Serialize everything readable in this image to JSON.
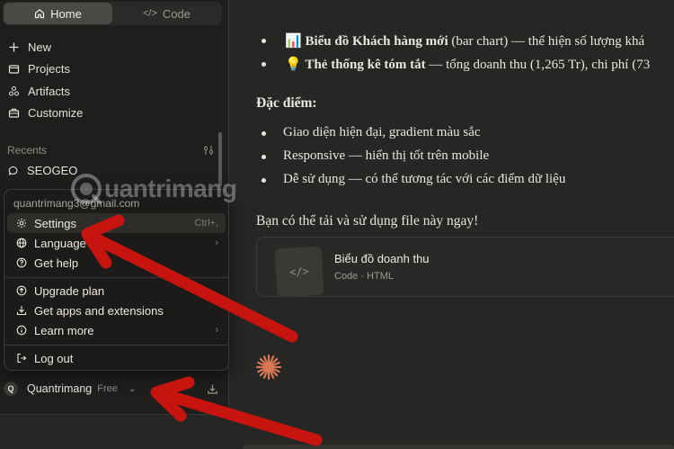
{
  "sidebar": {
    "modes": [
      {
        "label": "Home",
        "icon": "home-icon",
        "active": true
      },
      {
        "label": "Code",
        "icon": "code-icon",
        "active": false
      }
    ],
    "nav": [
      {
        "label": "New",
        "icon": "plus-icon"
      },
      {
        "label": "Projects",
        "icon": "folder-icon"
      },
      {
        "label": "Artifacts",
        "icon": "artifacts-icon"
      },
      {
        "label": "Customize",
        "icon": "briefcase-icon"
      }
    ],
    "recents_label": "Recents",
    "recent_item": "SEOGEO",
    "footer": {
      "avatar": "Q",
      "name": "Quantrimang",
      "plan": "Free"
    }
  },
  "menu": {
    "email": "quantrimang3@gmail.com",
    "items": [
      {
        "label": "Settings",
        "icon": "gear-icon",
        "shortcut": "Ctrl+,",
        "highlighted": true
      },
      {
        "label": "Language",
        "icon": "globe-icon",
        "submenu": true
      },
      {
        "label": "Get help",
        "icon": "help-icon"
      },
      {
        "label": "Upgrade plan",
        "icon": "upgrade-icon"
      },
      {
        "label": "Get apps and extensions",
        "icon": "download-icon"
      },
      {
        "label": "Learn more",
        "icon": "info-icon",
        "submenu": true
      },
      {
        "label": "Log out",
        "icon": "logout-icon"
      }
    ]
  },
  "main": {
    "bullet1": {
      "emoji": "📊",
      "bold": "Biểu đồ Khách hàng mới",
      "rest": " (bar chart) — thể hiện số lượng khá"
    },
    "bullet2": {
      "emoji": "💡",
      "bold": "Thẻ thống kê tóm tắt",
      "rest": " — tổng doanh thu (1,265 Tr), chi phí (73"
    },
    "features_heading": "Đặc điểm:",
    "features": [
      "Giao diện hiện đại, gradient màu sắc",
      "Responsive — hiển thị tốt trên mobile",
      "Dễ sử dụng — có thể tương tác với các điểm dữ liệu"
    ],
    "closing": "Bạn có thể tải và sử dụng file này ngay!",
    "artifact": {
      "title": "Biểu đồ doanh thu",
      "subtitle": "Code · HTML"
    }
  },
  "watermark": "uantrimang",
  "colors": {
    "arrow": "#c8140f",
    "spark": "#d97757",
    "highlight": "#2e2d2a"
  }
}
